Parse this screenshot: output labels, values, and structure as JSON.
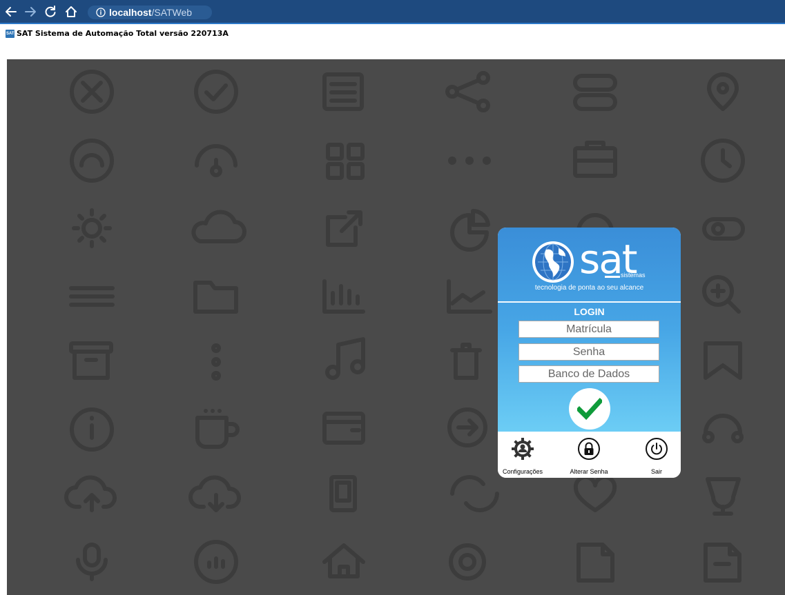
{
  "browser": {
    "url_host": "localhost",
    "url_path": "/SATWeb"
  },
  "page": {
    "title": "SAT Sistema de Automação Total versão 220713A",
    "favicon_text": "SAT"
  },
  "login_card": {
    "logo_text": "sat",
    "logo_subtext": "sistemas",
    "tagline": "tecnologia de ponta ao seu alcance",
    "heading": "LOGIN",
    "fields": {
      "matricula_placeholder": "Matrícula",
      "senha_placeholder": "Senha",
      "banco_placeholder": "Banco de Dados"
    },
    "submit_icon": "check-icon",
    "accent_color": "#0f9b3a"
  },
  "actions": {
    "config_label": "Configurações",
    "change_password_label": "Alterar Senha",
    "exit_label": "Sair"
  },
  "colors": {
    "browser_bar": "#1e4a7f",
    "background": "#4a4a4a",
    "card_gradient_top": "#3a8ed8",
    "card_gradient_bottom": "#6ccdf5"
  }
}
